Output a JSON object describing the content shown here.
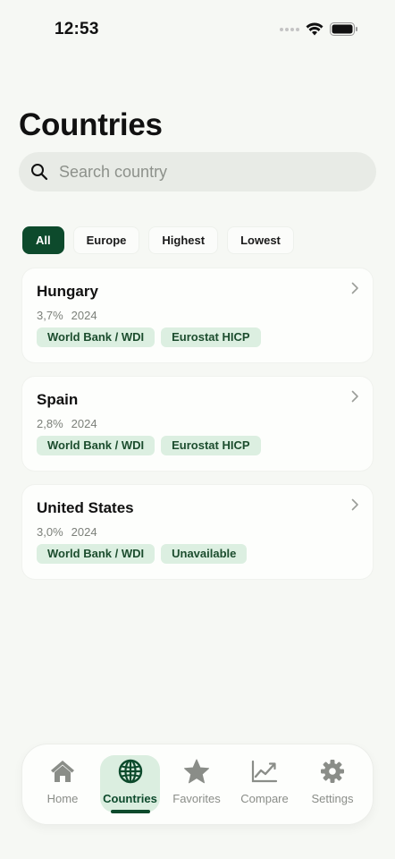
{
  "status": {
    "time": "12:53"
  },
  "title": "Countries",
  "search": {
    "placeholder": "Search country",
    "value": ""
  },
  "filters": [
    {
      "label": "All",
      "active": true
    },
    {
      "label": "Europe",
      "active": false
    },
    {
      "label": "Highest",
      "active": false
    },
    {
      "label": "Lowest",
      "active": false
    }
  ],
  "countries": [
    {
      "name": "Hungary",
      "rate": "3,7%",
      "year": "2024",
      "sources": [
        "World Bank / WDI",
        "Eurostat HICP"
      ]
    },
    {
      "name": "Spain",
      "rate": "2,8%",
      "year": "2024",
      "sources": [
        "World Bank / WDI",
        "Eurostat HICP"
      ]
    },
    {
      "name": "United States",
      "rate": "3,0%",
      "year": "2024",
      "sources": [
        "World Bank / WDI",
        "Unavailable"
      ]
    }
  ],
  "tabs": [
    {
      "label": "Home",
      "icon": "house-icon",
      "active": false
    },
    {
      "label": "Countries",
      "icon": "globe-icon",
      "active": true
    },
    {
      "label": "Favorites",
      "icon": "star-icon",
      "active": false
    },
    {
      "label": "Compare",
      "icon": "chart-line-icon",
      "active": false
    },
    {
      "label": "Settings",
      "icon": "gear-icon",
      "active": false
    }
  ],
  "colors": {
    "accent": "#0d4a2c",
    "tag_bg": "#dcefe1",
    "background": "#f6f8f4"
  }
}
